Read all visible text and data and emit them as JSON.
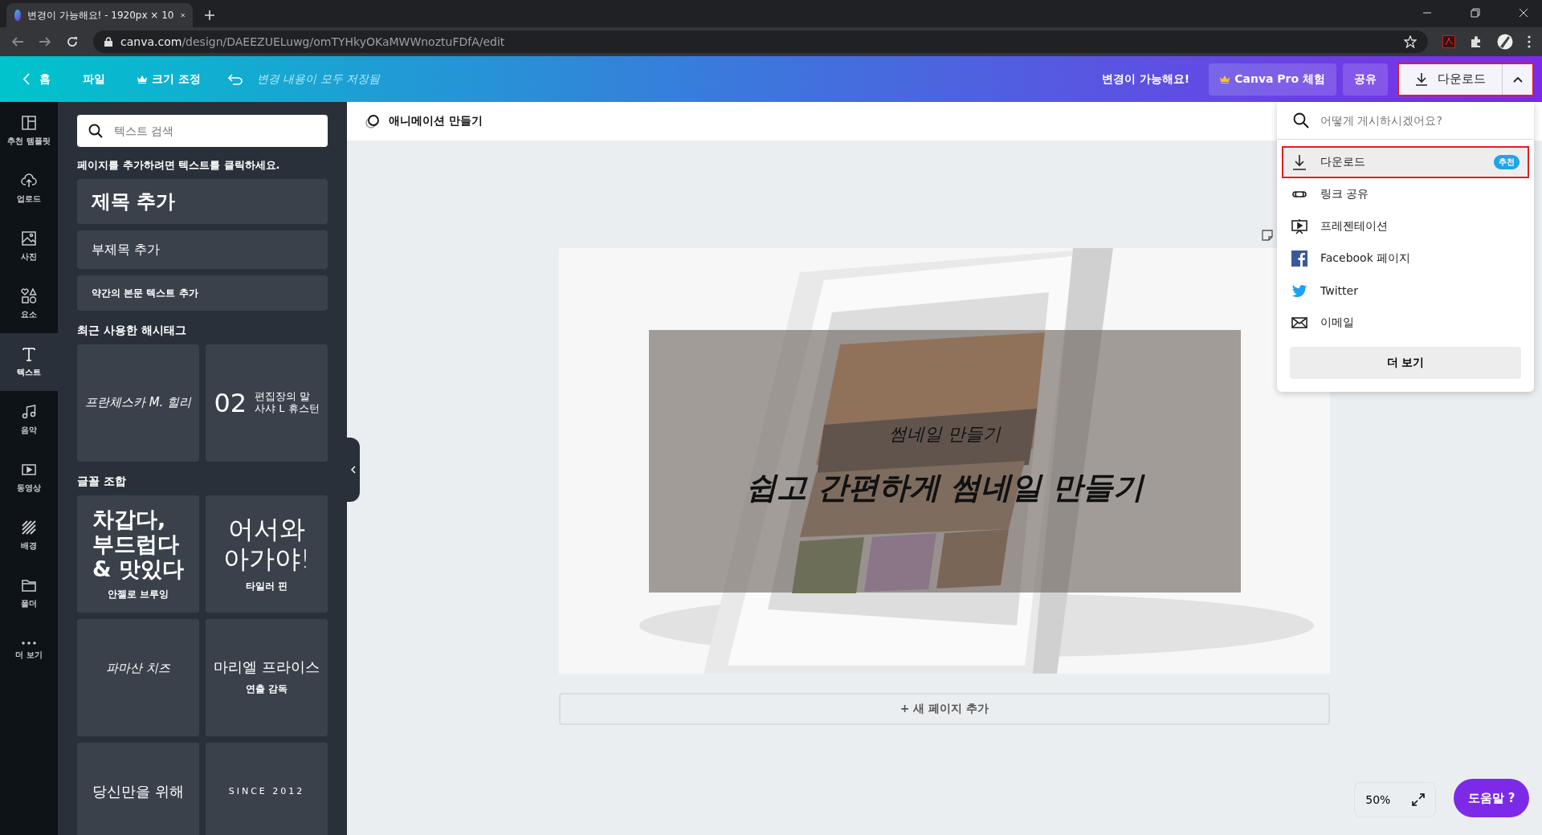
{
  "browser": {
    "tab_title": "변경이 가능해요! - 1920px × 10",
    "url_host": "canva.com",
    "url_path": "/design/DAEEZUELuwg/omTYHkyOKaMWWnoztuFDfA/edit"
  },
  "toolbar": {
    "home": "홈",
    "file": "파일",
    "resize": "크기 조정",
    "saved_status": "변경 내용이 모두 저장됨",
    "design_title": "변경이 가능해요!",
    "pro": "Canva Pro 체험",
    "share": "공유",
    "download": "다운로드"
  },
  "rail": [
    {
      "label": "추천 템플릿",
      "selected": false
    },
    {
      "label": "업로드",
      "selected": false
    },
    {
      "label": "사진",
      "selected": false
    },
    {
      "label": "요소",
      "selected": false
    },
    {
      "label": "텍스트",
      "selected": true
    },
    {
      "label": "음악",
      "selected": false
    },
    {
      "label": "동영상",
      "selected": false
    },
    {
      "label": "배경",
      "selected": false
    },
    {
      "label": "폴더",
      "selected": false
    },
    {
      "label": "더 보기",
      "selected": false
    }
  ],
  "panel": {
    "search_placeholder": "텍스트 검색",
    "hint": "페이지를 추가하려면 텍스트를 클릭하세요.",
    "add_text": [
      {
        "kind": "heading",
        "label": "제목 추가"
      },
      {
        "kind": "subheading",
        "label": "부제목 추가"
      },
      {
        "kind": "body",
        "label": "약간의 본문 텍스트 추가"
      }
    ],
    "hashtags_title": "최근 사용한 해시태그",
    "hashtags": [
      {
        "kind": "script",
        "lines": [
          "프란체스카 M. 힐리"
        ]
      },
      {
        "kind": "numbered",
        "number": "02",
        "lines": [
          "편집장의 말",
          "사샤 L 휴스턴"
        ]
      }
    ],
    "combos_title": "글꼴 조합",
    "combos": [
      {
        "kind": "bold",
        "lines": [
          "차갑다,",
          "부드럽다",
          "& 맛있다"
        ],
        "caption": "안젤로 브루잉"
      },
      {
        "kind": "light",
        "lines": [
          "어서와",
          "아가야!"
        ],
        "caption": "타일러 핀"
      },
      {
        "kind": "script",
        "lines": [
          "파마산 치즈"
        ]
      },
      {
        "kind": "serif",
        "lines": [
          "마리엘 프라이스"
        ],
        "caption": "연출 감독"
      },
      {
        "kind": "serif",
        "lines": [
          "당신만을 위해"
        ]
      },
      {
        "kind": "spaced",
        "lines": [
          "SINCE 2012"
        ]
      }
    ]
  },
  "editor": {
    "animate": "애니메이션 만들기",
    "design_subtitle": "썸네일 만들기",
    "design_title": "쉽고 간편하게 썸네일 만들기",
    "add_page": "+ 새 페이지 추가",
    "zoom": "50%",
    "help": "도움말 ?"
  },
  "share_menu": {
    "search_placeholder": "어떻게 게시하시겠어요?",
    "items": [
      {
        "label": "다운로드",
        "selected": true,
        "badge": "추천"
      },
      {
        "label": "링크 공유",
        "selected": false
      },
      {
        "label": "프레젠테이션",
        "selected": false
      },
      {
        "label": "Facebook 페이지",
        "selected": false
      },
      {
        "label": "Twitter",
        "selected": false
      },
      {
        "label": "이메일",
        "selected": false
      }
    ],
    "more": "더 보기"
  }
}
